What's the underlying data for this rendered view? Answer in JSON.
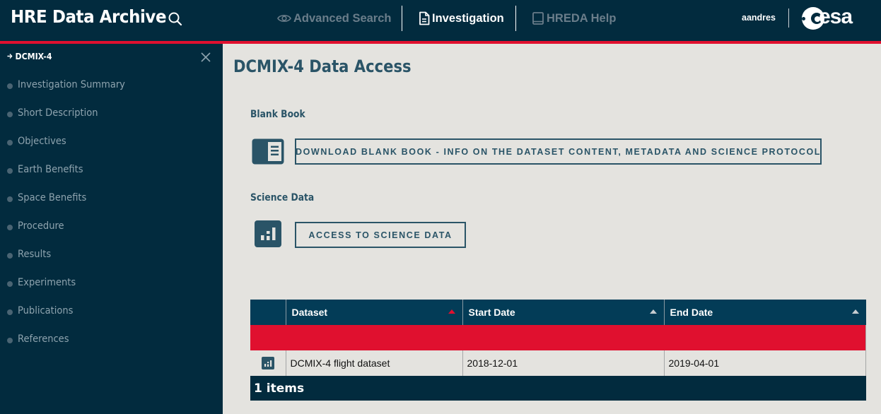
{
  "header": {
    "app_title": "HRE Data Archive",
    "nav": [
      {
        "label": "Advanced Search",
        "icon": "eye-icon",
        "state": "disabled"
      },
      {
        "label": "Investigation",
        "icon": "document-icon",
        "state": "active"
      },
      {
        "label": "HREDA Help",
        "icon": "book-icon",
        "state": "disabled"
      }
    ],
    "username": "aandres",
    "logo_text": "esa"
  },
  "sidebar": {
    "title": "DCMIX-4",
    "items": [
      {
        "label": "Investigation Summary"
      },
      {
        "label": "Short Description"
      },
      {
        "label": "Objectives"
      },
      {
        "label": "Earth Benefits"
      },
      {
        "label": "Space Benefits"
      },
      {
        "label": "Procedure"
      },
      {
        "label": "Results"
      },
      {
        "label": "Experiments"
      },
      {
        "label": "Publications"
      },
      {
        "label": "References"
      }
    ]
  },
  "main": {
    "page_title": "DCMIX-4 Data Access",
    "blank_book": {
      "section_label": "Blank Book",
      "button_label": "DOWNLOAD BLANK BOOK - INFO ON THE DATASET CONTENT, METADATA AND SCIENCE PROTOCOL"
    },
    "science_data": {
      "section_label": "Science Data",
      "button_label": "ACCESS TO SCIENCE DATA"
    },
    "table": {
      "columns": [
        {
          "label": "",
          "sortable": false
        },
        {
          "label": "Dataset",
          "sortable": true,
          "sort_active": true
        },
        {
          "label": "Start Date",
          "sortable": true,
          "sort_active": false
        },
        {
          "label": "End Date",
          "sortable": true,
          "sort_active": false
        }
      ],
      "rows": [
        {
          "dataset": "DCMIX-4 flight dataset",
          "start_date": "2018-12-01",
          "end_date": "2019-04-01"
        }
      ],
      "footer": "1 items"
    }
  },
  "colors": {
    "header_bg": "#022b3e",
    "accent_red": "#e0102f",
    "primary_teal": "#2a5467",
    "table_header_bg": "#033c57",
    "page_bg": "#e4e3df"
  }
}
